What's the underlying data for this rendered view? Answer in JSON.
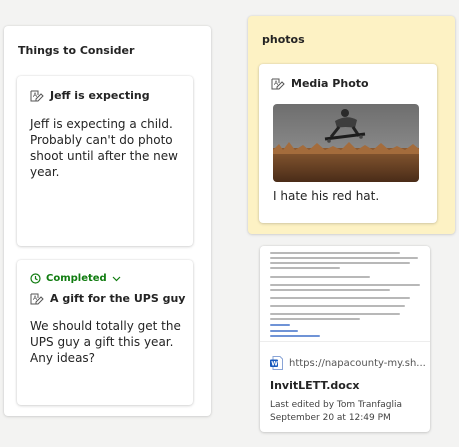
{
  "columns": {
    "consider": {
      "title": "Things to Consider",
      "cards": [
        {
          "title": "Jeff is expecting",
          "body": "Jeff is expecting a child. Probably can't do photo shoot until after the new year."
        },
        {
          "status": "Completed",
          "title": "A gift for the UPS guy",
          "body": "We should totally get the UPS guy a gift this year. Any ideas?"
        }
      ]
    },
    "photos": {
      "title": "photos",
      "card": {
        "title": "Media Photo",
        "caption": "I hate his red hat."
      }
    }
  },
  "document_card": {
    "url": "https://napacounty-my.sh...",
    "filename": "InvitLETT.docx",
    "meta": "Last edited by Tom Tranfaglia September 20 at 12:49 PM"
  },
  "colors": {
    "completed": "#107c10",
    "photos_column_bg": "#fdf2c4",
    "word_blue": "#185abd"
  },
  "icons": [
    "note-icon",
    "clock-icon",
    "chevron-down-icon",
    "word-doc-icon"
  ]
}
